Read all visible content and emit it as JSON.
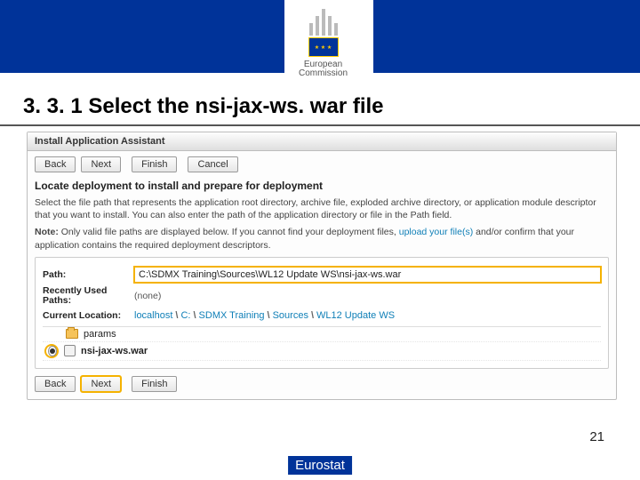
{
  "slide": {
    "title": "3. 3. 1 Select the nsi-jax-ws. war file",
    "page_number": "21",
    "footer_label": "Eurostat",
    "logo": {
      "line1": "European",
      "line2": "Commission"
    }
  },
  "panel": {
    "title": "Install Application Assistant",
    "buttons_top": {
      "back": "Back",
      "next": "Next",
      "finish": "Finish",
      "cancel": "Cancel"
    },
    "buttons_bottom": {
      "back": "Back",
      "next": "Next",
      "finish": "Finish"
    },
    "section_heading": "Locate deployment to install and prepare for deployment",
    "para1": "Select the file path that represents the application root directory, archive file, exploded archive directory, or application module descriptor that you want to install. You can also enter the path of the application directory or file in the Path field.",
    "note_label": "Note:",
    "note_text": " Only valid file paths are displayed below. If you cannot find your deployment files, ",
    "note_link": "upload your file(s)",
    "note_text2": " and/or confirm that your application contains the required deployment descriptors.",
    "path_label": "Path:",
    "path_value": "C:\\SDMX Training\\Sources\\WL12 Update WS\\nsi-jax-ws.war",
    "recent_label": "Recently Used Paths:",
    "recent_value": "(none)",
    "location_label": "Current Location:",
    "crumb": {
      "host": "localhost",
      "segs": [
        "C:",
        "SDMX Training",
        "Sources",
        "WL12 Update WS"
      ]
    },
    "files": {
      "folder": "params",
      "war": "nsi-jax-ws.war"
    }
  }
}
